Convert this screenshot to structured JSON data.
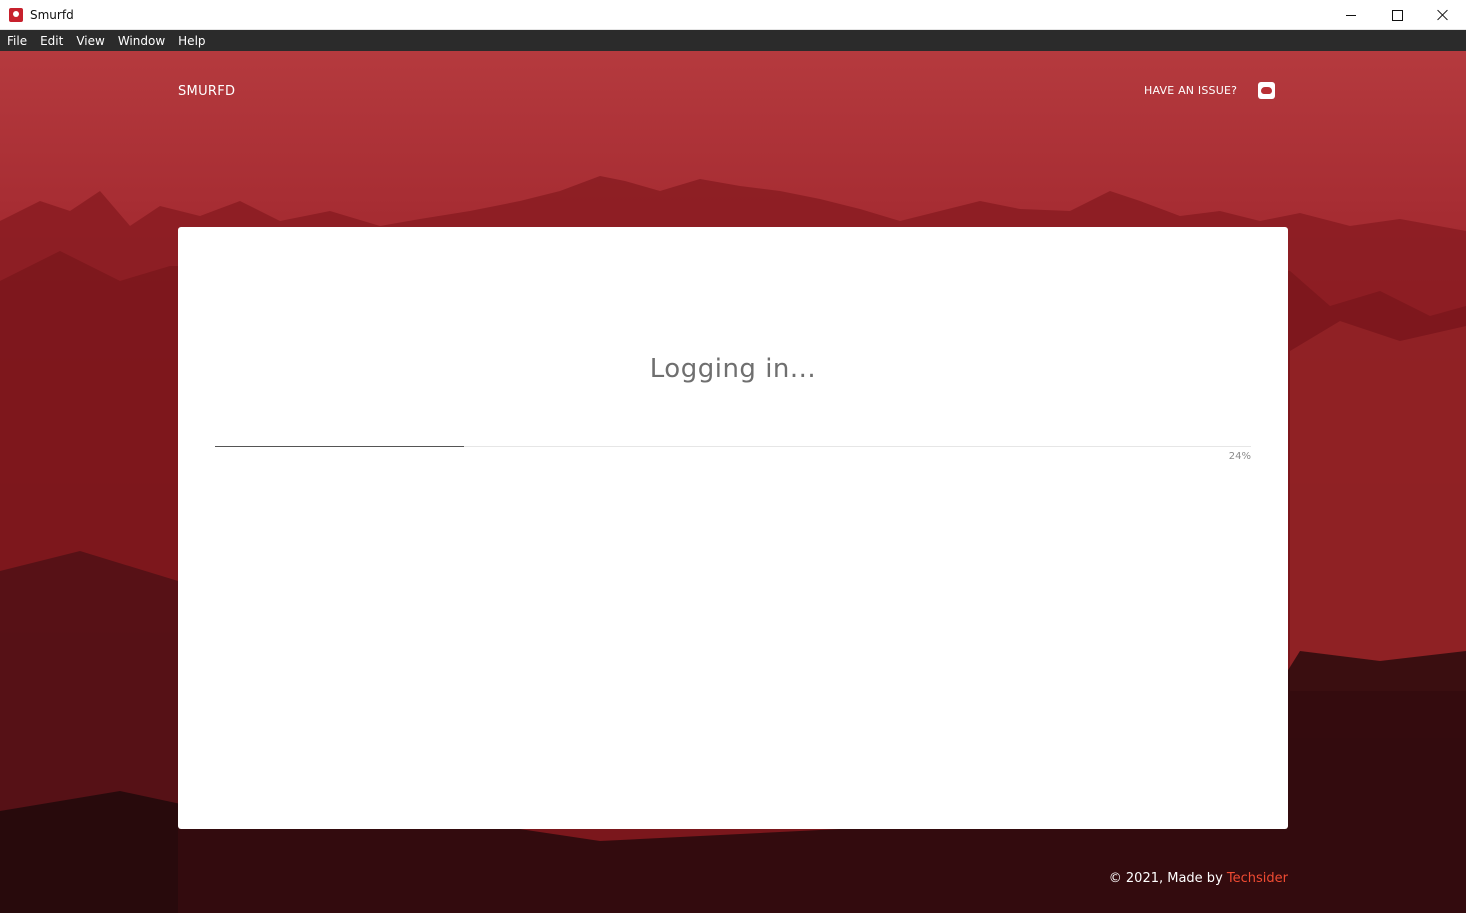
{
  "window": {
    "title": "Smurfd",
    "controls": {
      "minimize": "minimize",
      "maximize": "maximize",
      "close": "close"
    }
  },
  "menu": {
    "items": [
      "File",
      "Edit",
      "View",
      "Window",
      "Help"
    ]
  },
  "header": {
    "brand": "SMURFD",
    "issue_link": "HAVE AN ISSUE?",
    "discord_icon": "discord-icon"
  },
  "card": {
    "status": "Logging in...",
    "progress": {
      "value": 0.24,
      "label": "24%"
    }
  },
  "footer": {
    "text": "© 2021, Made by ",
    "link": "Techsider"
  },
  "colors": {
    "accent": "#f04b32",
    "menubar": "#2b2b2b",
    "background_red": "#9b2228"
  }
}
